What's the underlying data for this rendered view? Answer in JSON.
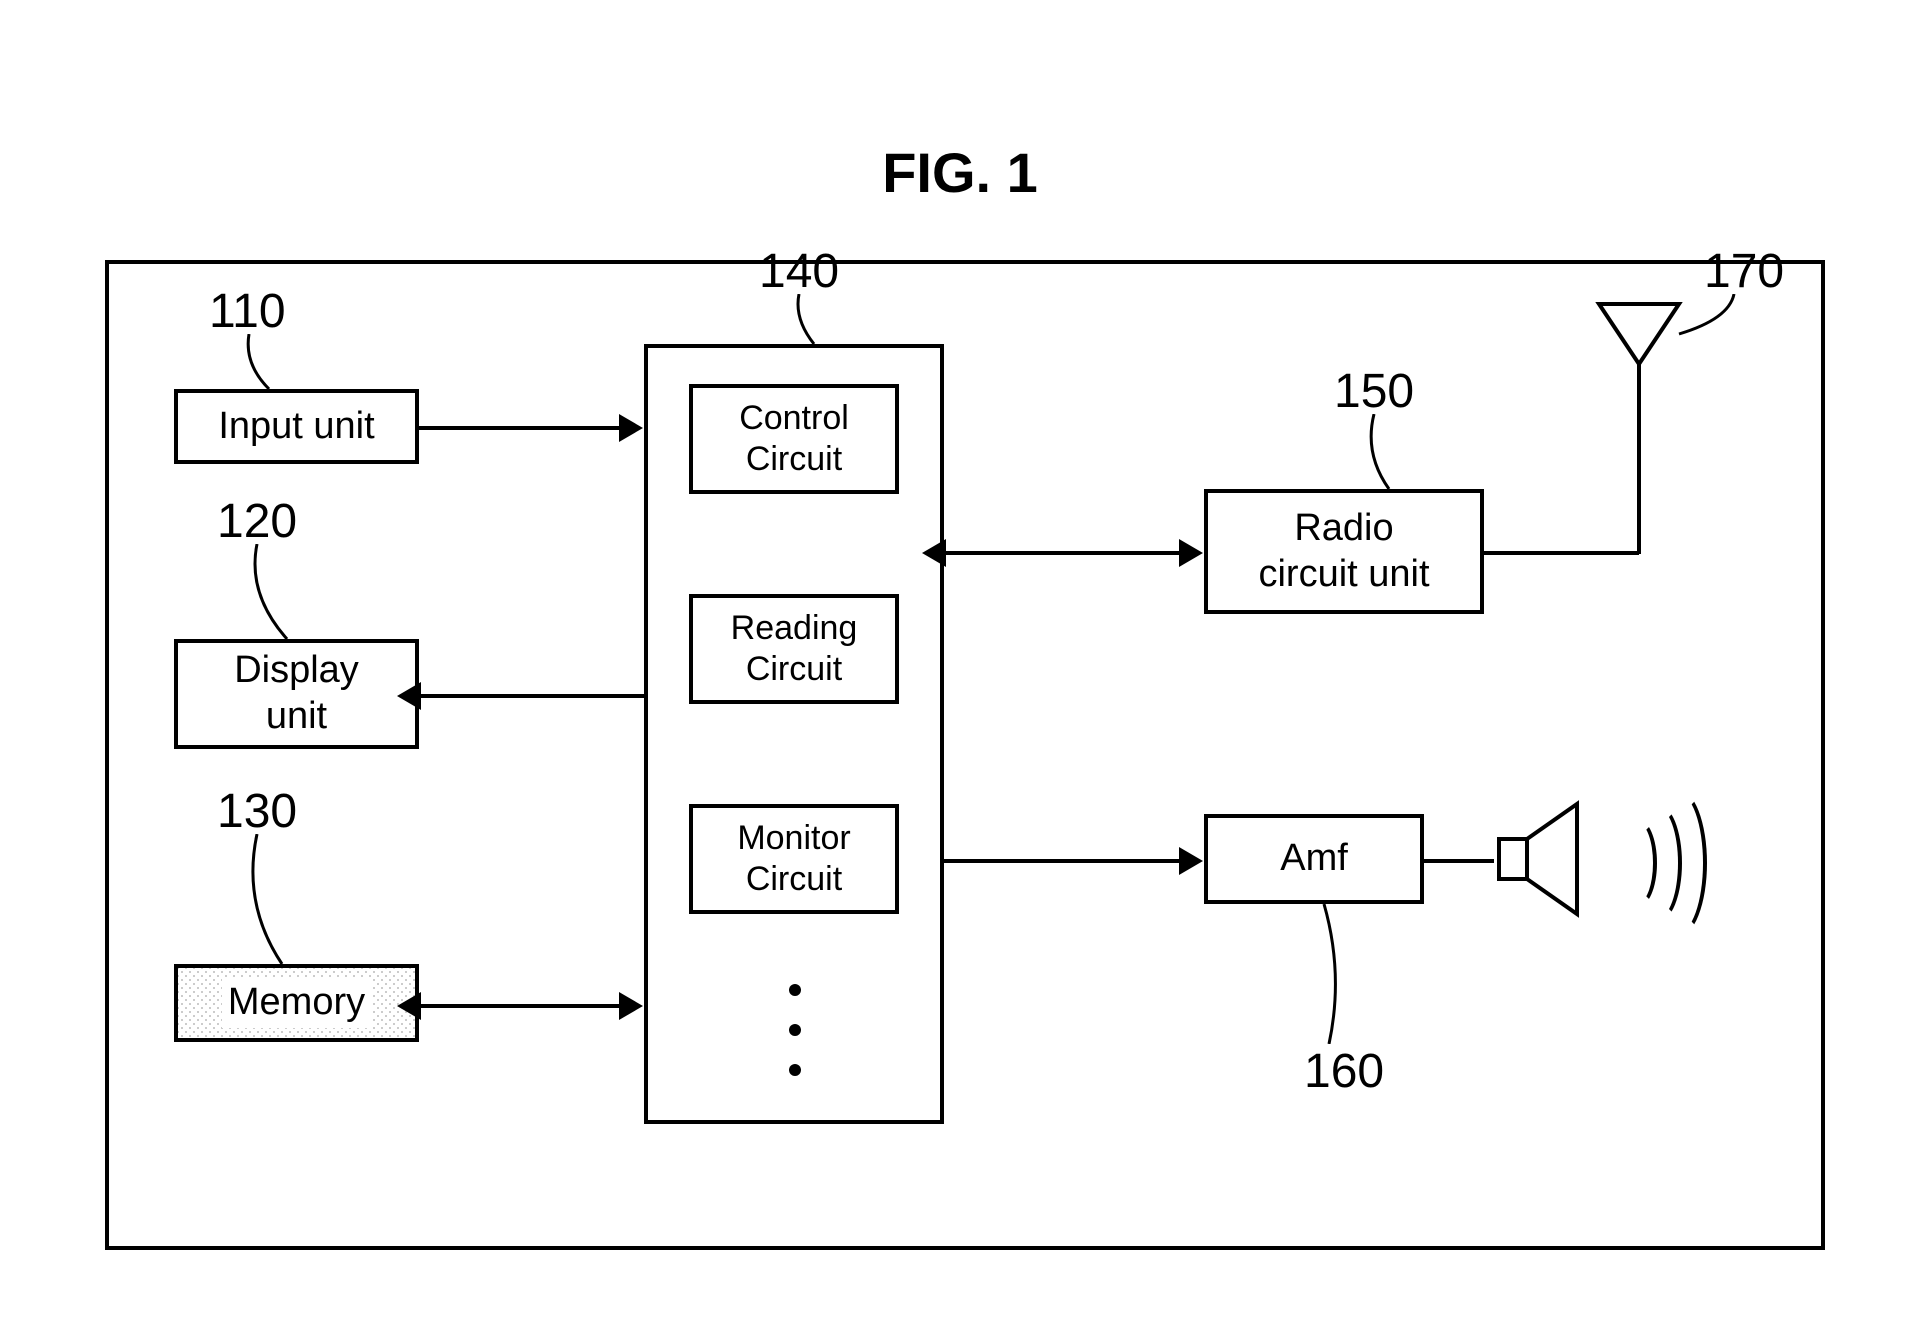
{
  "figure": {
    "title": "FIG. 1"
  },
  "refs": {
    "input": "110",
    "display": "120",
    "memory": "130",
    "center": "140",
    "radio": "150",
    "amf": "160",
    "antenna": "170"
  },
  "blocks": {
    "input": "Input unit",
    "display": "Display\nunit",
    "memory": "Memory",
    "control": "Control\nCircuit",
    "reading": "Reading\nCircuit",
    "monitor": "Monitor\nCircuit",
    "radio": "Radio\ncircuit unit",
    "amf": "Amf"
  }
}
